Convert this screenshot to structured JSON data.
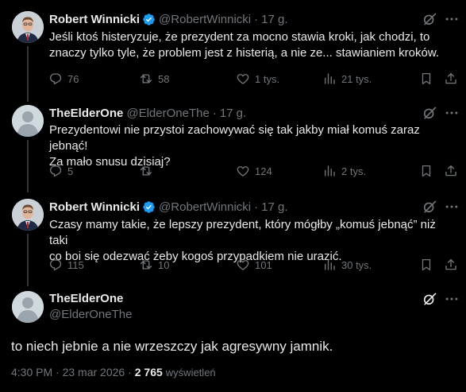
{
  "tweets": [
    {
      "author": "Robert Winnicki",
      "handle": "@RobertWinnicki",
      "time": "17 g.",
      "text": "Jeśli ktoś histeryzuje, że prezydent za mocno stawia kroki, jak chodzi, to\nznaczy tylko tyle, że problem jest z histerią, a nie ze... stawianiem kroków.",
      "replies": "76",
      "reposts": "58",
      "likes": "1 tys.",
      "views": "21 tys."
    },
    {
      "author": "TheElderOne",
      "handle": "@ElderOneThe",
      "time": "17 g.",
      "text": "Prezydentowi nie przystoi zachowywać się tak jakby miał komuś zaraz jebnąć!\nZa mało snusu dzisiaj?",
      "replies": "5",
      "reposts": "",
      "likes": "124",
      "views": "2 tys."
    },
    {
      "author": "Robert Winnicki",
      "handle": "@RobertWinnicki",
      "time": "17 g.",
      "text": "Czasy mamy takie, że lepszy prezydent, który mógłby „komuś jebnąć” niż taki\nco boi się odezwać żeby kogoś przypadkiem nie urazić.",
      "replies": "115",
      "reposts": "10",
      "likes": "101",
      "views": "30 tys."
    }
  ],
  "main": {
    "author": "TheElderOne",
    "handle": "@ElderOneThe",
    "text": "to niech jebnie a nie wrzeszczy jak agresywny jamnik.",
    "timestamp": "4:30 PM · 23 mar 2026 ·",
    "views": "2 765",
    "views_label": "wyświetleń"
  },
  "icons": {
    "reply": "reply-icon",
    "repost": "repost-icon",
    "like": "heart-icon",
    "views": "views-icon",
    "bookmark": "bookmark-icon",
    "share": "share-icon",
    "grok": "grok-icon",
    "verified": "verified-badge-icon"
  },
  "colors": {
    "background": "#000000",
    "text": "#e7e9ea",
    "muted": "#71767b",
    "verified": "#1d9bf0"
  }
}
